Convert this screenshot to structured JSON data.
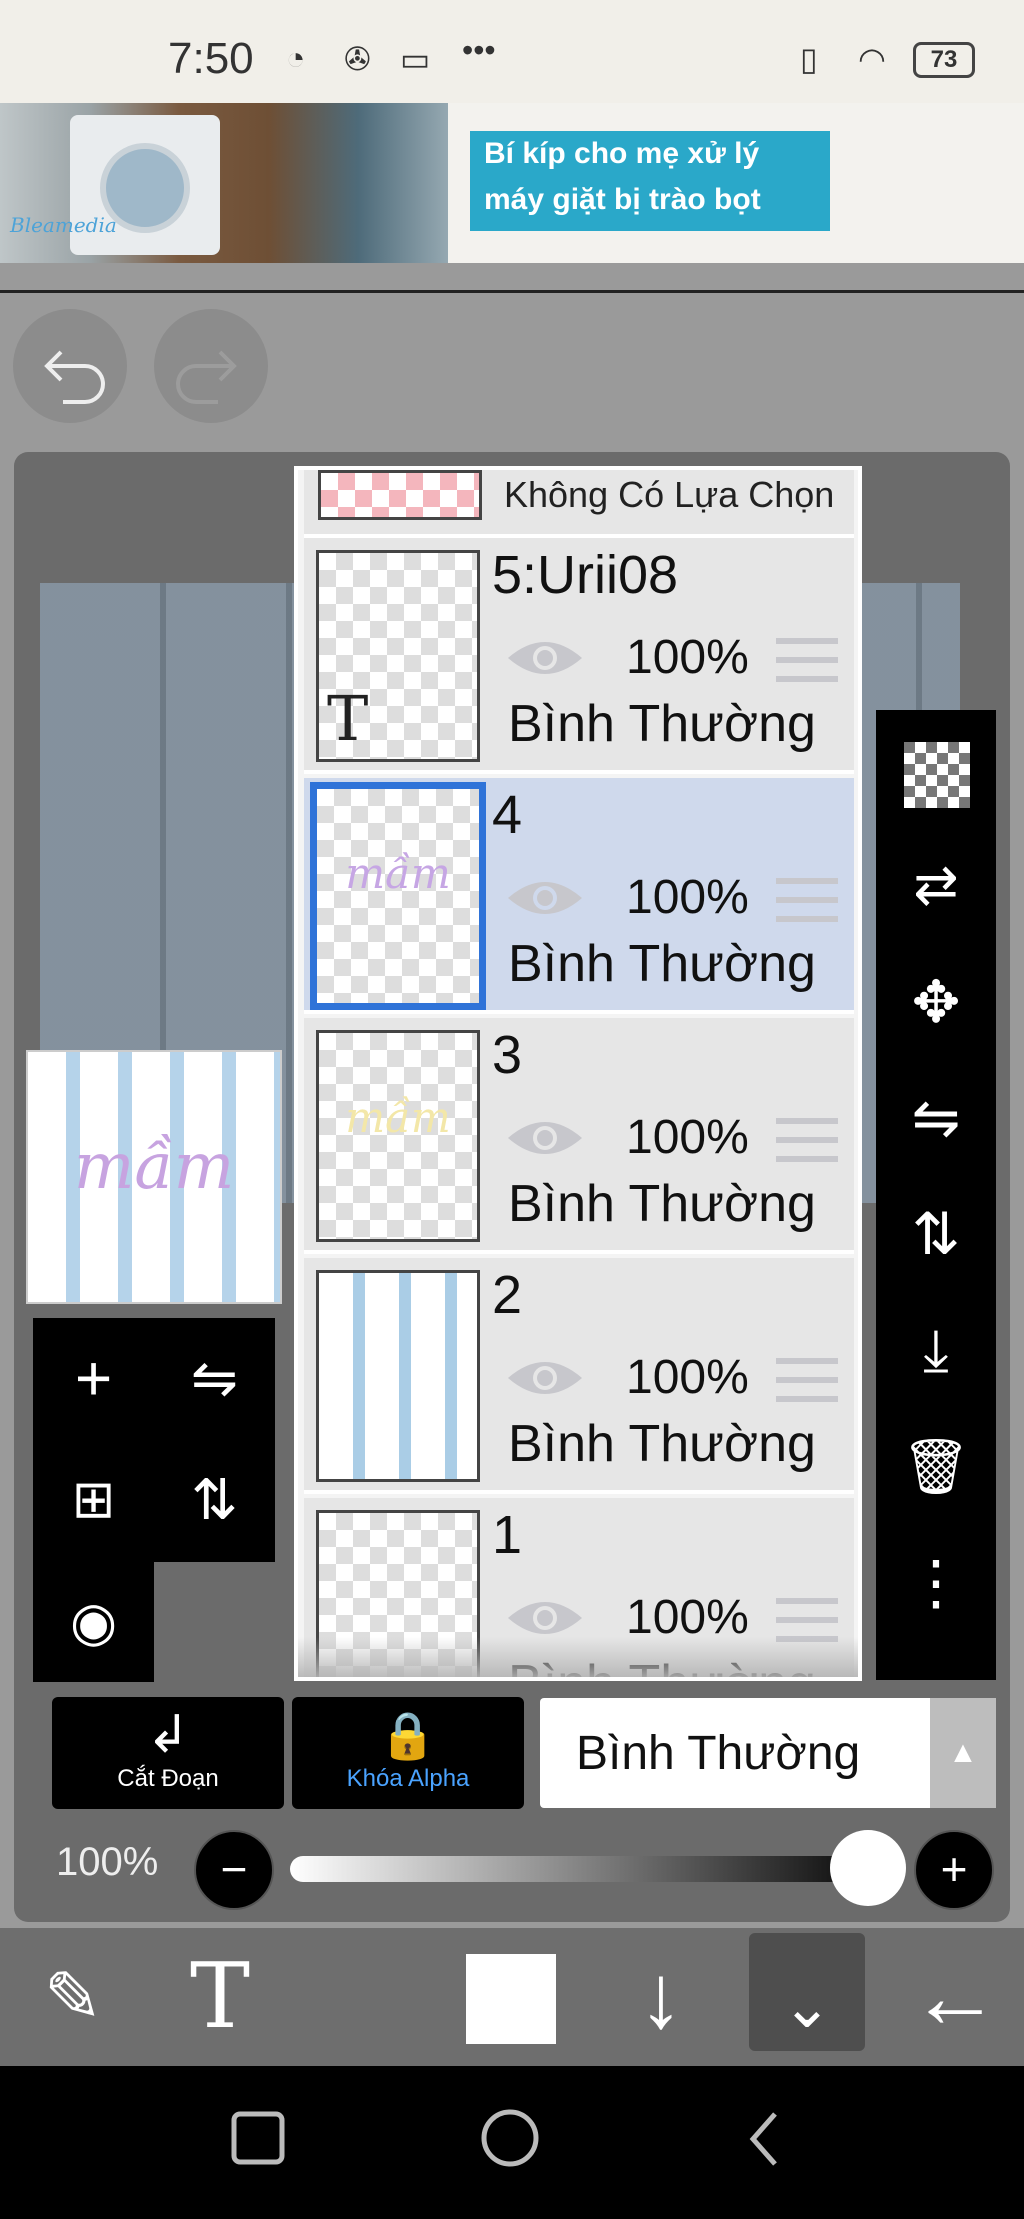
{
  "status_bar": {
    "time": "7:50",
    "notification_icons": [
      "messenger-icon",
      "game-controller-icon",
      "screen-icon",
      "more-dots-icon"
    ],
    "battery_level": "73"
  },
  "ad": {
    "brand": "Bleamedia",
    "headline_line1": "Bí kíp cho mẹ xử lý",
    "headline_line2": "máy giặt bị trào bọt"
  },
  "layers_panel": {
    "top_row_label": "Không Có Lựa Chọn",
    "layers": [
      {
        "name": "5:Urii08",
        "opacity": "100%",
        "blend": "Bình Thường",
        "selected": false,
        "thumbnail": "text-layer"
      },
      {
        "name": "4",
        "opacity": "100%",
        "blend": "Bình Thường",
        "selected": true,
        "thumbnail": "lettering-pastel"
      },
      {
        "name": "3",
        "opacity": "100%",
        "blend": "Bình Thường",
        "selected": false,
        "thumbnail": "lettering-yellow"
      },
      {
        "name": "2",
        "opacity": "100%",
        "blend": "Bình Thường",
        "selected": false,
        "thumbnail": "blue-plaid"
      },
      {
        "name": "1",
        "opacity": "100%",
        "blend": "Bình Thường",
        "selected": false,
        "thumbnail": "empty"
      }
    ]
  },
  "bottom_controls": {
    "clip_label": "Cắt Đoạn",
    "alpha_lock_label": "Khóa Alpha",
    "blend_mode": "Bình Thường",
    "opacity_value": "100%",
    "opacity_fraction": 1.0
  },
  "colors": {
    "selected_accent": "#2f73d8",
    "alpha_lock": "#4aa3ff",
    "selected_row_bg": "#cfd9ec"
  }
}
